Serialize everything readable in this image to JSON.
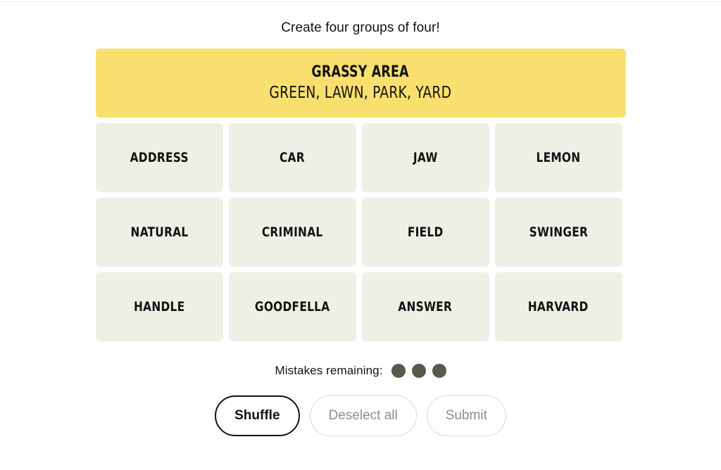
{
  "instruction": "Create four groups of four!",
  "colors": {
    "yellow_group": "#f9df6d",
    "tile_background": "#efefe6",
    "mistake_dot": "#5a594e",
    "text": "#121212",
    "disabled_text": "#8d8d8d"
  },
  "solved_groups": [
    {
      "title": "GRASSY AREA",
      "members": "GREEN, LAWN, PARK, YARD",
      "color": "#f9df6d"
    }
  ],
  "tile_rows": [
    [
      "ADDRESS",
      "CAR",
      "JAW",
      "LEMON"
    ],
    [
      "NATURAL",
      "CRIMINAL",
      "FIELD",
      "SWINGER"
    ],
    [
      "HANDLE",
      "GOODFELLA",
      "ANSWER",
      "HARVARD"
    ]
  ],
  "mistakes": {
    "label": "Mistakes remaining:",
    "remaining": 3,
    "dots": [
      "filled",
      "filled",
      "filled"
    ]
  },
  "buttons": {
    "shuffle": "Shuffle",
    "deselect_all": "Deselect all",
    "submit": "Submit"
  }
}
